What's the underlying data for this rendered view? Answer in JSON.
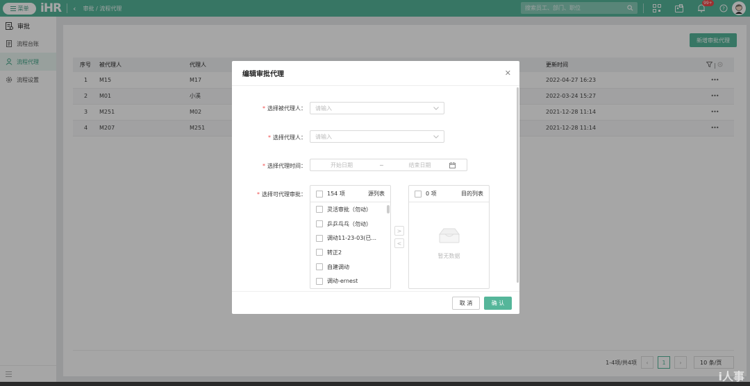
{
  "colors": {
    "brand": "#55b69a",
    "required": "#f04b4b",
    "badge": "#f04b4b"
  },
  "topbar": {
    "menu_label": "菜单",
    "logo": "iHR",
    "breadcrumb": "审批  /  流程代理",
    "search_placeholder": "搜索员工、部门、职位",
    "notification_badge": "99+"
  },
  "sidebar": {
    "header": "审批",
    "items": [
      {
        "label": "流程台账",
        "icon": "document-icon"
      },
      {
        "label": "流程代理",
        "icon": "person-icon"
      },
      {
        "label": "流程设置",
        "icon": "gear-icon"
      }
    ],
    "active": "流程代理"
  },
  "main": {
    "add_button": "新增审批代理",
    "table": {
      "headers": [
        "序号",
        "被代理人",
        "代理人",
        "更新时间"
      ],
      "rows": [
        {
          "no": "1",
          "principal": "M15",
          "agent": "M17",
          "updated": "2022-04-27 16:23"
        },
        {
          "no": "2",
          "principal": "M01",
          "agent": "小溪",
          "updated": "2022-03-24 15:27"
        },
        {
          "no": "3",
          "principal": "M251",
          "agent": "M02",
          "updated": "2021-12-28 11:14"
        },
        {
          "no": "4",
          "principal": "M207",
          "agent": "M251",
          "updated": "2021-12-28 11:14"
        }
      ],
      "row_action": "•••"
    },
    "pagination": {
      "summary": "1-4项/共4项",
      "current_page": "1",
      "page_size": "10 条/页"
    }
  },
  "modal": {
    "title": "编辑审批代理",
    "fields": {
      "principal_label": "选择被代理人：",
      "principal_placeholder": "请输入",
      "agent_label": "选择代理人：",
      "agent_placeholder": "请输入",
      "time_label": "选择代理时间：",
      "start_placeholder": "开始日期",
      "range_sep": "~",
      "end_placeholder": "结束日期",
      "approvals_label": "选择可代理审批："
    },
    "transfer": {
      "source": {
        "count": "154 项",
        "title": "源列表",
        "items": [
          "灵活审批（勿动）",
          "乒乒乓乓（勿动）",
          "调动11-23-03(已...",
          "转正2",
          "自建调动",
          "调动-ernest"
        ]
      },
      "target": {
        "count": "0 项",
        "title": "目的列表",
        "empty_text": "暂无数据"
      },
      "to_right": ">",
      "to_left": "<"
    },
    "cancel_label": "取 消",
    "confirm_label": "确 认"
  },
  "watermark": "i人事"
}
